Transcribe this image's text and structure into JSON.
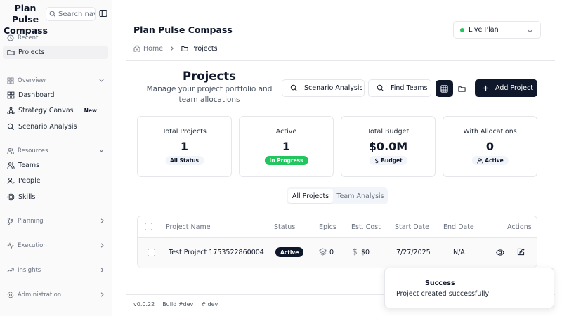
{
  "app": {
    "title": "Plan Pulse Compass"
  },
  "sidebar": {
    "search_placeholder": "Search navigation...",
    "recent": {
      "label": "Recent",
      "items": [
        {
          "label": "Projects",
          "icon": "folder-icon"
        }
      ]
    },
    "overview": {
      "label": "Overview",
      "items": [
        {
          "label": "Dashboard",
          "icon": "dashboard-icon"
        },
        {
          "label": "Strategy Canvas",
          "icon": "network-icon",
          "badge": "New"
        },
        {
          "label": "Scenario Analysis",
          "icon": "search-icon"
        }
      ]
    },
    "resources": {
      "label": "Resources",
      "items": [
        {
          "label": "Teams",
          "icon": "users-icon"
        },
        {
          "label": "People",
          "icon": "user-icon"
        },
        {
          "label": "Skills",
          "icon": "target-icon"
        }
      ]
    },
    "collapsed_groups": [
      {
        "label": "Planning",
        "icon": "branch-icon"
      },
      {
        "label": "Execution",
        "icon": "activity-icon"
      },
      {
        "label": "Insights",
        "icon": "trending-icon"
      },
      {
        "label": "Administration",
        "icon": "settings-icon"
      }
    ]
  },
  "header": {
    "title": "Plan Pulse Compass",
    "mode_select": {
      "value": "Live Plan",
      "status_color": "#22c55e"
    },
    "breadcrumb": [
      "Home",
      "Projects"
    ]
  },
  "page": {
    "title": "Projects",
    "subtitle": "Manage your project portfolio and team allocations",
    "actions": {
      "scenario_analysis": "Scenario Analysis",
      "find_teams": "Find Teams",
      "add_project": "Add Project"
    }
  },
  "stats": [
    {
      "label": "Total Projects",
      "value": "1",
      "badge": "All Status",
      "badge_style": "gray"
    },
    {
      "label": "Active",
      "value": "1",
      "badge": "In Progress",
      "badge_style": "green"
    },
    {
      "label": "Total Budget",
      "value": "$0.0M",
      "badge": "Budget",
      "badge_style": "gray"
    },
    {
      "label": "With Allocations",
      "value": "0",
      "badge": "Active",
      "badge_style": "gray"
    }
  ],
  "tabs": [
    {
      "label": "All Projects",
      "active": true
    },
    {
      "label": "Team Analysis",
      "active": false
    }
  ],
  "table": {
    "columns": [
      "Project Name",
      "Status",
      "Epics",
      "Est. Cost",
      "Start Date",
      "End Date",
      "Actions"
    ],
    "rows": [
      {
        "name": "Test Project 1753522860004",
        "status": "Active",
        "epics": "0",
        "cost": "$0",
        "start": "7/27/2025",
        "end": "N/A"
      }
    ]
  },
  "footer": {
    "version": "v0.0.22",
    "build": "Build #dev",
    "hash": "# dev"
  },
  "toast": {
    "title": "Success",
    "message": "Project created successfully"
  },
  "colors": {
    "primary": "#0f172a",
    "success": "#22c55e",
    "border": "#e5e7eb",
    "muted": "#6b7280"
  }
}
